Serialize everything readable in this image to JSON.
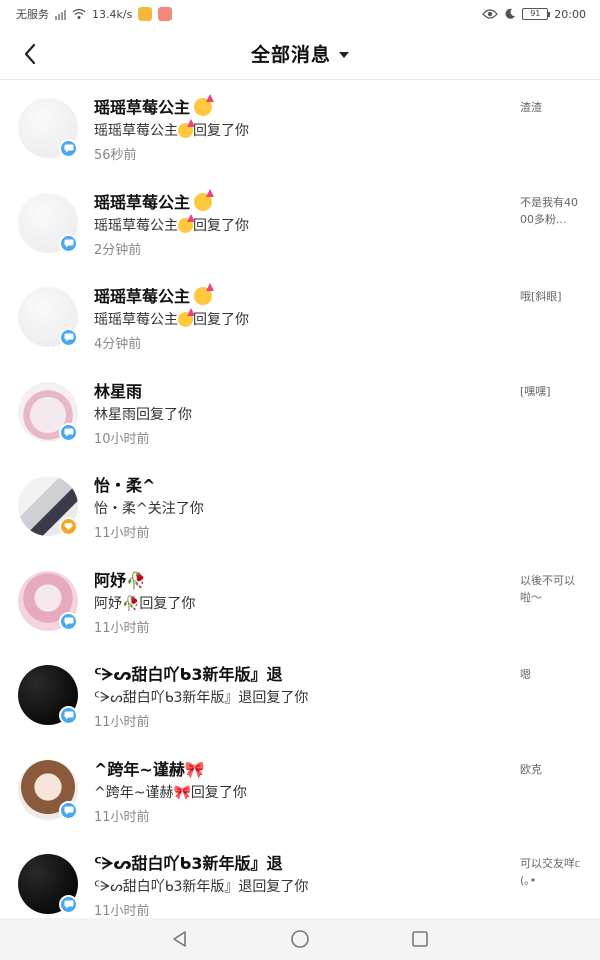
{
  "status_bar": {
    "carrier": "无服务",
    "speed": "13.4k/s",
    "battery": "91",
    "time": "20:00"
  },
  "header": {
    "title": "全部消息"
  },
  "messages": [
    {
      "name": "瑶瑶草莓公主",
      "name_emoji": true,
      "action": "瑶瑶草莓公主",
      "action_emoji": true,
      "action_suffix": "回复了你",
      "time": "56秒前",
      "preview": "渣渣",
      "badge": "comment",
      "avatar": "blank"
    },
    {
      "name": "瑶瑶草莓公主",
      "name_emoji": true,
      "action": "瑶瑶草莓公主",
      "action_emoji": true,
      "action_suffix": "回复了你",
      "time": "2分钟前",
      "preview": "不是我有4000多粉...",
      "badge": "comment",
      "avatar": "blank"
    },
    {
      "name": "瑶瑶草莓公主",
      "name_emoji": true,
      "action": "瑶瑶草莓公主",
      "action_emoji": true,
      "action_suffix": "回复了你",
      "time": "4分钟前",
      "preview": "哦[斜眼]",
      "badge": "comment",
      "avatar": "blank"
    },
    {
      "name": "林星雨",
      "name_emoji": false,
      "action": "林星雨回复了你",
      "action_emoji": false,
      "action_suffix": "",
      "time": "10小时前",
      "preview": "[嘿嘿]",
      "badge": "comment",
      "avatar": "anime-pink"
    },
    {
      "name": "怡・柔^",
      "name_emoji": false,
      "action": "怡・柔^关注了你",
      "action_emoji": false,
      "action_suffix": "",
      "time": "11小时前",
      "preview": "",
      "badge": "follow",
      "avatar": "anime-mask"
    },
    {
      "name": "阿妤🥀",
      "name_emoji": false,
      "action": "阿妤🥀回复了你",
      "action_emoji": false,
      "action_suffix": "",
      "time": "11小时前",
      "preview": "以後不可以啦～",
      "badge": "comment",
      "avatar": "anime-girl"
    },
    {
      "name": "ᑦᗒᔕ甜白吖ᑲ3新年版』退",
      "name_emoji": false,
      "action": "ᑦᗒᔕ甜白吖ᑲ3新年版』退回复了你",
      "action_emoji": false,
      "action_suffix": "",
      "time": "11小时前",
      "preview": "嗯",
      "badge": "comment",
      "avatar": "dark"
    },
    {
      "name": "^跨年~谨赫🎀",
      "name_emoji": false,
      "action": "^跨年~谨赫🎀回复了你",
      "action_emoji": false,
      "action_suffix": "",
      "time": "11小时前",
      "preview": "欧克",
      "badge": "comment",
      "avatar": "anime-brown"
    },
    {
      "name": "ᑦᗒᔕ甜白吖ᑲ3新年版』退",
      "name_emoji": false,
      "action": "ᑦᗒᔕ甜白吖ᑲ3新年版』退回复了你",
      "action_emoji": false,
      "action_suffix": "",
      "time": "11小时前",
      "preview": "可以交友咩ᥴ(｡•",
      "badge": "comment",
      "avatar": "dark"
    }
  ],
  "colors": {
    "badge_comment": "#4aa8f0",
    "badge_follow": "#f5a623"
  }
}
